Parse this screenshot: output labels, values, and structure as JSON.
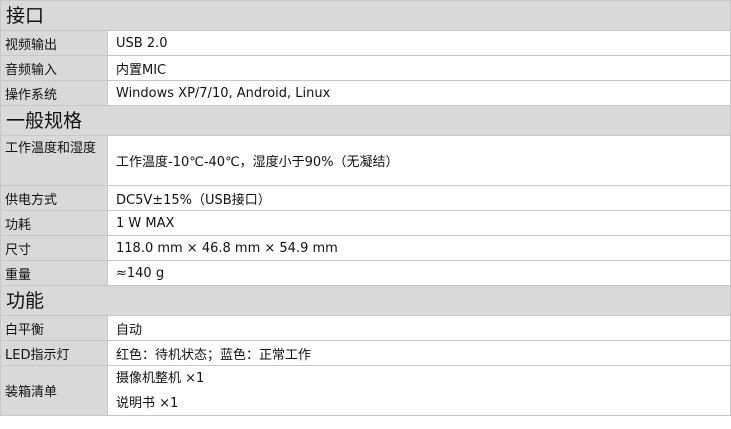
{
  "sections": [
    {
      "title": "接口",
      "rows": [
        {
          "label": "视频输出",
          "value": "USB 2.0"
        },
        {
          "label": "音频输入",
          "value": "内置MIC"
        },
        {
          "label": "操作系统",
          "value": "Windows XP/7/10, Android, Linux"
        }
      ]
    },
    {
      "title": "一般规格",
      "rows": [
        {
          "label": "工作温度和湿度",
          "value": "工作温度-10℃-40℃，湿度小于90%（无凝结）"
        },
        {
          "label": "供电方式",
          "value": "DC5V±15%（USB接口）"
        },
        {
          "label": "功耗",
          "value": "1 W MAX"
        },
        {
          "label": "尺寸",
          "value": "118.0 mm × 46.8 mm × 54.9 mm"
        },
        {
          "label": "重量",
          "value": "≈140 g"
        }
      ]
    },
    {
      "title": "功能",
      "rows": [
        {
          "label": "白平衡",
          "value": "自动"
        },
        {
          "label": "LED指示灯",
          "value": "红色：待机状态；蓝色：正常工作"
        },
        {
          "label": "装箱清单",
          "values": [
            "摄像机整机 ×1",
            "说明书 ×1"
          ]
        }
      ]
    }
  ]
}
